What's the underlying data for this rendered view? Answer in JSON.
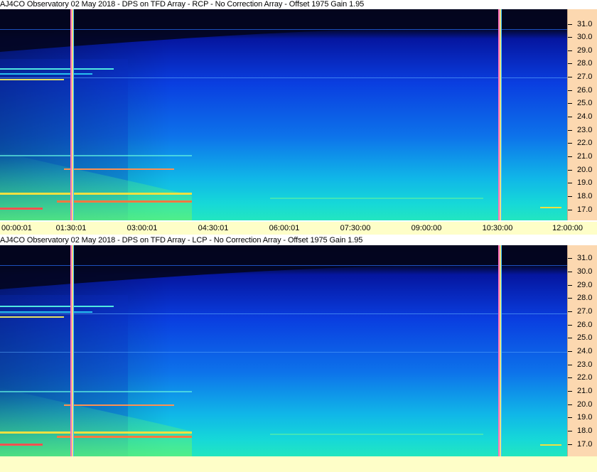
{
  "panels": [
    {
      "title": "AJ4CO Observatory 02 May 2018 - DPS on TFD Array  - RCP  -  No Correction Array  -  Offset 1975  Gain 1.95",
      "freq_ticks": [
        "31.0",
        "30.0",
        "29.0",
        "28.0",
        "27.0",
        "26.0",
        "25.0",
        "24.0",
        "23.0",
        "22.0",
        "21.0",
        "20.0",
        "19.0",
        "18.0",
        "17.0"
      ],
      "time_labels": [
        "00:00:01",
        "01:30:01",
        "03:00:01",
        "04:30:01",
        "06:00:01",
        "07:30:00",
        "09:00:00",
        "10:30:00",
        "12:00:00"
      ]
    },
    {
      "title": "AJ4CO Observatory 02 May 2018 - DPS on TFD Array  - LCP  -  No Correction Array  -  Offset 1975  Gain 1.95",
      "freq_ticks": [
        "31.0",
        "30.0",
        "29.0",
        "28.0",
        "27.0",
        "26.0",
        "25.0",
        "24.0",
        "23.0",
        "22.0",
        "21.0",
        "20.0",
        "19.0",
        "18.0",
        "17.0"
      ]
    }
  ],
  "colors": {
    "scale_bg": "#fcd8b0",
    "timebar_bg": "#fefec8",
    "sky_dark": "#020414",
    "band_blue": "#0a3ad8",
    "band_cyan": "#10c8e8",
    "band_green": "#38e8a0"
  }
}
